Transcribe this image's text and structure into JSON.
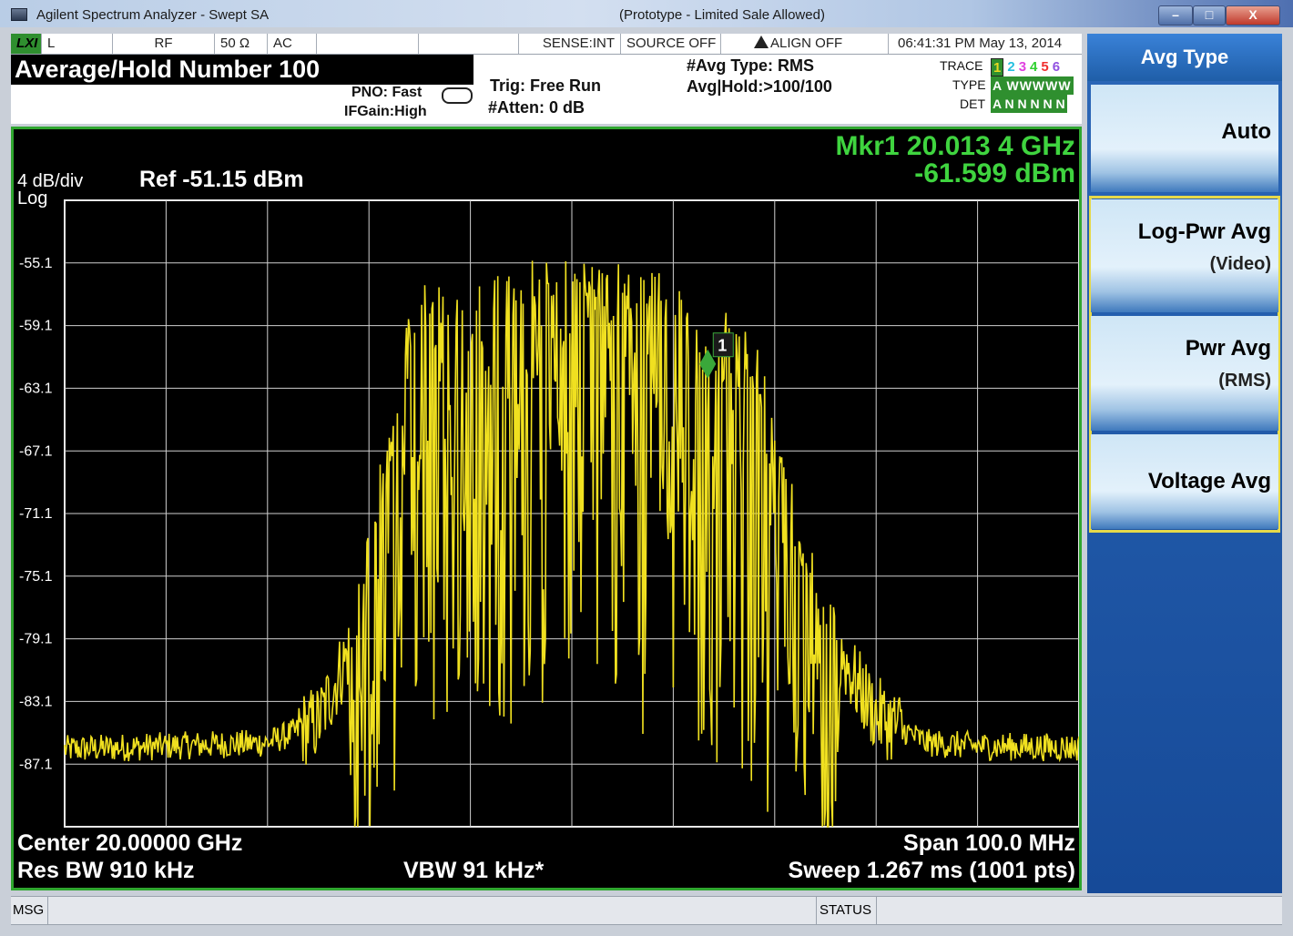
{
  "window": {
    "title": "Agilent Spectrum Analyzer - Swept SA",
    "note": "(Prototype - Limited Sale Allowed)",
    "minimize": "–",
    "maximize": "□",
    "close": "X"
  },
  "status_strip": {
    "lxi": "LXI",
    "l": "L",
    "rf": "RF",
    "impedance": "50 Ω",
    "coupling": "AC",
    "sense": "SENSE:INT",
    "source": "SOURCE OFF",
    "align": "ALIGN OFF",
    "datetime": "06:41:31 PM May 13, 2014"
  },
  "header": {
    "mode_title": "Average/Hold Number 100",
    "pno": "PNO: Fast",
    "ifgain": "IFGain:High",
    "trig": "Trig: Free Run",
    "atten": "#Atten: 0 dB",
    "avg_type": "#Avg Type: RMS",
    "avg_hold": "Avg|Hold:>100/100",
    "trace_label": "TRACE",
    "type_label": "TYPE",
    "det_label": "DET",
    "trace_numbers": [
      "1",
      "2",
      "3",
      "4",
      "5",
      "6"
    ],
    "trace_colors": [
      "#e8d820",
      "#27c0e0",
      "#e040e0",
      "#30d030",
      "#f03030",
      "#9050e0"
    ],
    "type_values": "A WWWWW",
    "det_values": "A N N N N N"
  },
  "display": {
    "scale": "4 dB/div",
    "scale_type": "Log",
    "ref": "Ref -51.15 dBm",
    "marker_freq": "Mkr1 20.013 4 GHz",
    "marker_amp": "-61.599 dBm",
    "marker_label": "1",
    "center": "Center 20.00000 GHz",
    "span": "Span 100.0 MHz",
    "res_bw": "Res BW 910 kHz",
    "vbw": "VBW 91 kHz*",
    "sweep": "Sweep   1.267 ms (1001 pts)"
  },
  "chart_data": {
    "type": "line",
    "title": "",
    "xlabel": "",
    "ylabel": "",
    "y_ticks": [
      "-55.1",
      "-59.1",
      "-63.1",
      "-67.1",
      "-71.1",
      "-75.1",
      "-79.1",
      "-83.1",
      "-87.1"
    ],
    "ylim": [
      -91.15,
      -51.15
    ],
    "xlim": [
      19950,
      20050
    ],
    "x_unit": "MHz",
    "y_unit": "dBm",
    "grid": true,
    "series": [
      {
        "color": "#f0e020",
        "x": [
          19950,
          19960,
          19970,
          19975,
          19978,
          19980,
          19982,
          19984,
          19986,
          19990,
          19995,
          20000,
          20005,
          20010,
          20013.4,
          20015,
          20018,
          20020,
          20022,
          20025,
          20028,
          20030,
          20035,
          20040,
          20050
        ],
        "values": [
          -86.2,
          -86.0,
          -85.8,
          -84.5,
          -80,
          -74,
          -66,
          -60,
          -58,
          -59,
          -57,
          -56,
          -57,
          -58,
          -61.6,
          -60,
          -62,
          -66,
          -72,
          -78,
          -82,
          -84,
          -85.8,
          -86.0,
          -86.1
        ]
      }
    ],
    "markers": [
      {
        "label": "1",
        "x": 20013.4,
        "y": -61.599
      }
    ]
  },
  "softkeys": {
    "title": "Avg Type",
    "items": [
      {
        "label": "Auto",
        "sub": ""
      },
      {
        "label": "Log-Pwr Avg",
        "sub": "(Video)"
      },
      {
        "label": "Pwr Avg",
        "sub": "(RMS)"
      },
      {
        "label": "Voltage Avg",
        "sub": ""
      }
    ]
  },
  "bottom_bar": {
    "msg": "MSG",
    "status": "STATUS"
  }
}
